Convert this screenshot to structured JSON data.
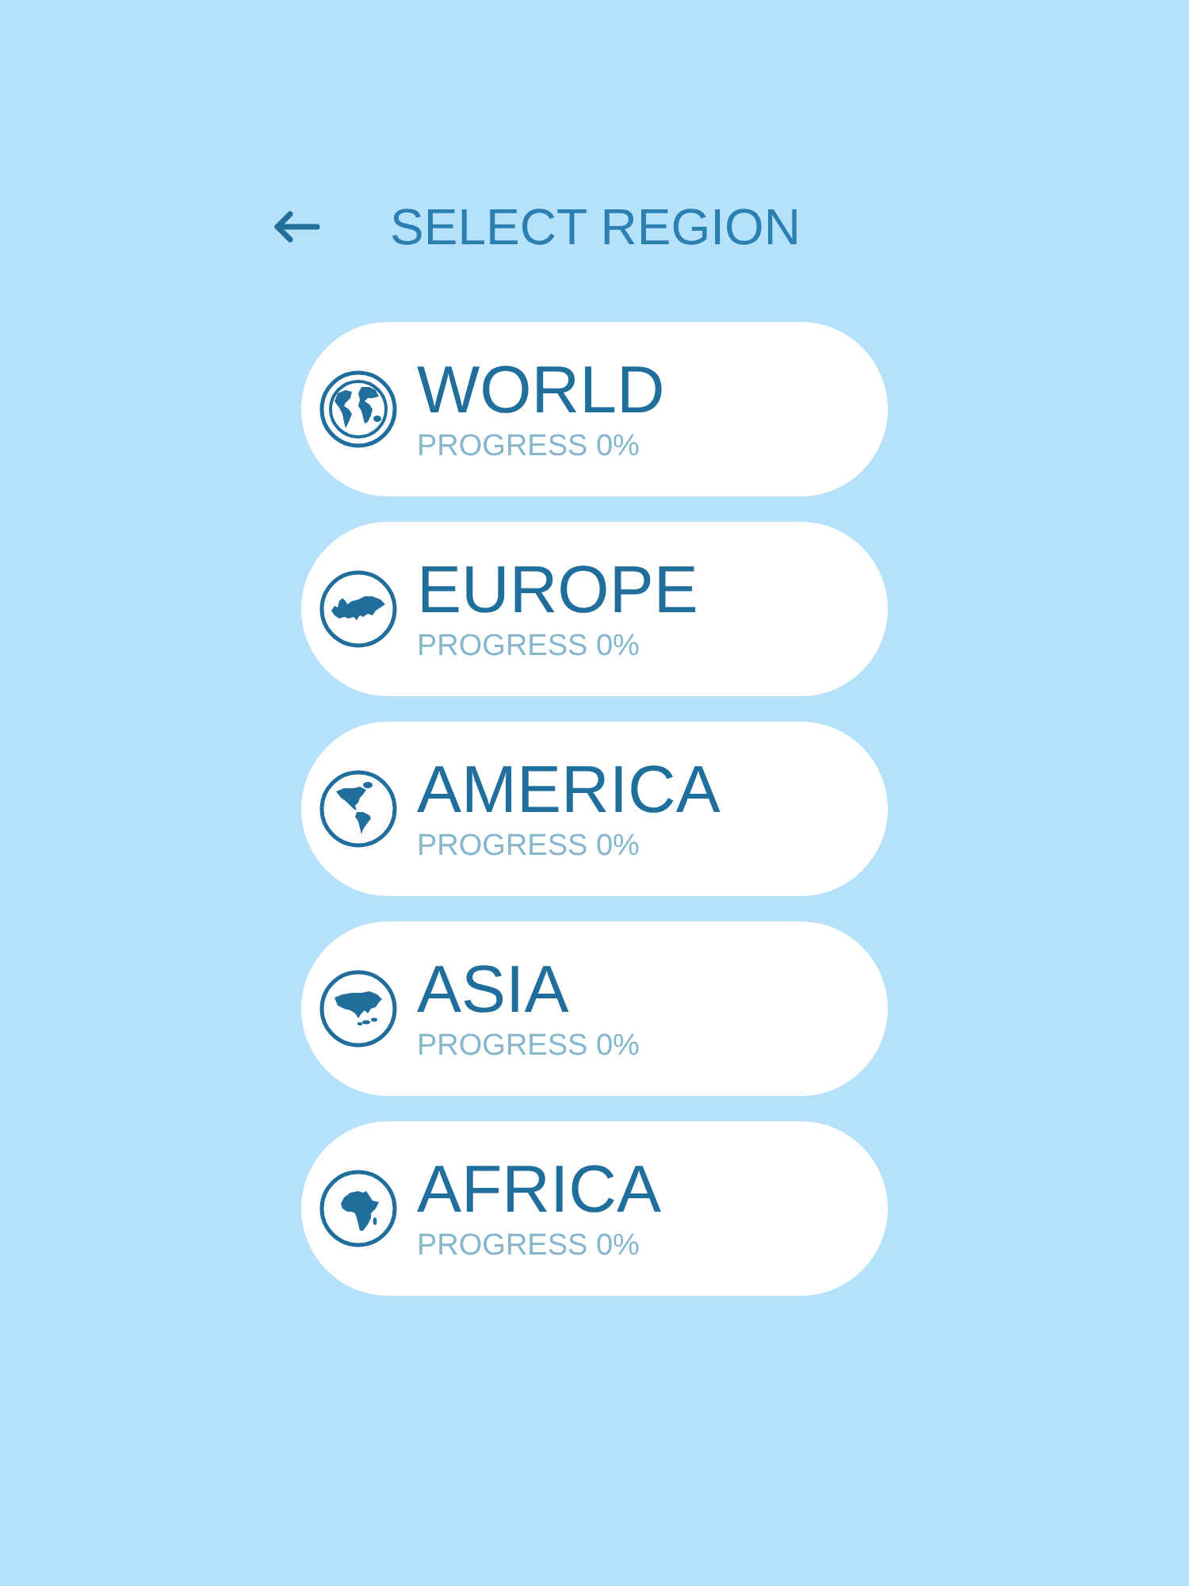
{
  "header": {
    "title": "SELECT REGION"
  },
  "regions": [
    {
      "kind": "globe",
      "name": "WORLD",
      "progress": "PROGRESS 0%"
    },
    {
      "kind": "europe",
      "name": "EUROPE",
      "progress": "PROGRESS 0%"
    },
    {
      "kind": "america",
      "name": "AMERICA",
      "progress": "PROGRESS 0%"
    },
    {
      "kind": "asia",
      "name": "ASIA",
      "progress": "PROGRESS 0%"
    },
    {
      "kind": "africa",
      "name": "AFRICA",
      "progress": "PROGRESS 0%"
    }
  ]
}
